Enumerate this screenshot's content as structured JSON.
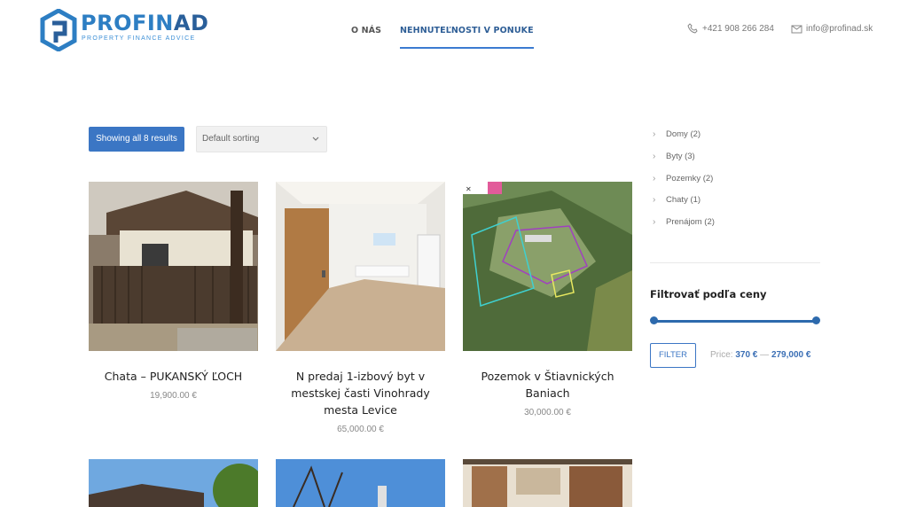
{
  "header": {
    "logo_main": "PROFIN",
    "logo_suffix": "AD",
    "logo_tagline": "PROPERTY FINANCE ADVICE",
    "nav": [
      {
        "label": "O NÁS",
        "active": false
      },
      {
        "label": "NEHNUTEĽNOSTI V PONUKE",
        "active": true
      }
    ],
    "phone": "+421 908 266 284",
    "email": "info@profinad.sk"
  },
  "toolbar": {
    "results_label": "Showing all 8 results",
    "sort_value": "Default sorting"
  },
  "products": [
    {
      "title": "Chata – PUKANSKÝ ĽOCH",
      "price": "19,900.00 €"
    },
    {
      "title": "N predaj 1-izbový byt v mestskej časti Vinohrady mesta Levice",
      "price": "65,000.00 €"
    },
    {
      "title": "Pozemok v Štiavnických Baniach",
      "price": "30,000.00 €"
    }
  ],
  "sidebar": {
    "categories": [
      {
        "label": "Domy (2)"
      },
      {
        "label": "Byty (3)"
      },
      {
        "label": "Pozemky (2)"
      },
      {
        "label": "Chaty (1)"
      },
      {
        "label": "Prenájom (2)"
      }
    ],
    "filter_title": "Filtrovať podľa ceny",
    "filter_button": "FILTER",
    "price_prefix": "Price:",
    "price_min": "370 €",
    "price_sep": "—",
    "price_max": "279,000 €"
  },
  "colors": {
    "accent": "#3b76c4",
    "brand": "#2d7ec3"
  },
  "icons": [
    "logo-hexagon-icon",
    "phone-icon",
    "mail-icon",
    "chevron-down-icon",
    "chevron-right-icon"
  ]
}
